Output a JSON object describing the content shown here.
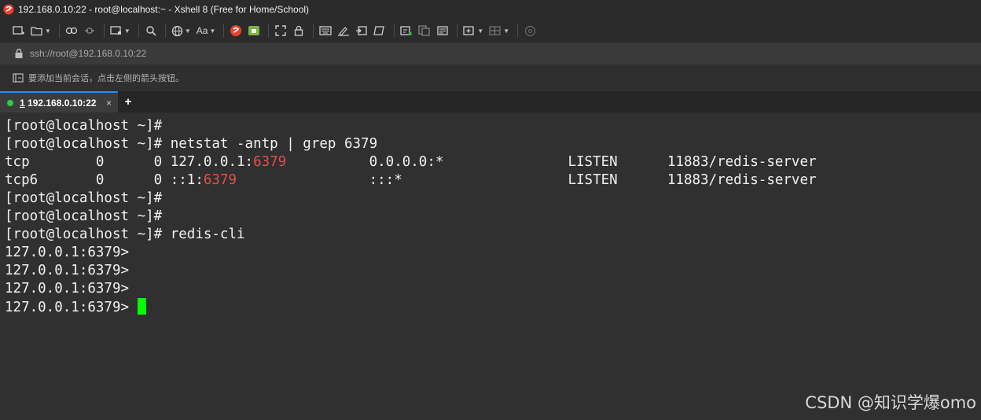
{
  "window": {
    "title": "192.168.0.10:22 - root@localhost:~ - Xshell 8 (Free for Home/School)",
    "app_icon": "xshell-logo-icon"
  },
  "toolbar": {
    "font_label": "Aa",
    "buttons": [
      "new-session-icon",
      "open-folder-icon",
      "reconnect-icon",
      "disconnect-icon",
      "new-window-icon",
      "find-icon",
      "globe-icon",
      "font-icon",
      "xshell-icon",
      "xftp-icon",
      "fullscreen-icon",
      "lock-icon",
      "keyboard-icon",
      "highlight-icon",
      "script-icon",
      "compose-icon",
      "new-tab-icon",
      "copy-icon",
      "paste-icon",
      "add-folder-icon",
      "layout-icon",
      "help-icon"
    ]
  },
  "address": {
    "url": "ssh://root@192.168.0.10:22"
  },
  "hint": {
    "text": "要添加当前会话，点击左侧的箭头按钮。"
  },
  "tabs": {
    "active": {
      "number": "1",
      "label": "192.168.0.10:22",
      "status_color": "#2ecc40"
    },
    "close_symbol": "×",
    "new_symbol": "+"
  },
  "terminal": {
    "lines": [
      {
        "text": "[root@localhost ~]#"
      },
      {
        "text": "[root@localhost ~]# netstat -antp | grep 6379"
      },
      {
        "pre": "tcp        0      0 127.0.0.1:",
        "hl": "6379",
        "post": "          0.0.0.0:*               LISTEN      11883/redis-server"
      },
      {
        "pre": "tcp6       0      0 ::1:",
        "hl": "6379",
        "post": "                :::*                    LISTEN      11883/redis-server"
      },
      {
        "text": "[root@localhost ~]#"
      },
      {
        "text": "[root@localhost ~]#"
      },
      {
        "text": "[root@localhost ~]# redis-cli"
      },
      {
        "text": "127.0.0.1:6379>"
      },
      {
        "text": "127.0.0.1:6379>"
      },
      {
        "text": "127.0.0.1:6379>"
      },
      {
        "text": "127.0.0.1:6379> "
      }
    ],
    "highlight_color": "#e05050",
    "cursor_color": "#00ff00"
  },
  "watermark": "CSDN @知识学爆omo"
}
